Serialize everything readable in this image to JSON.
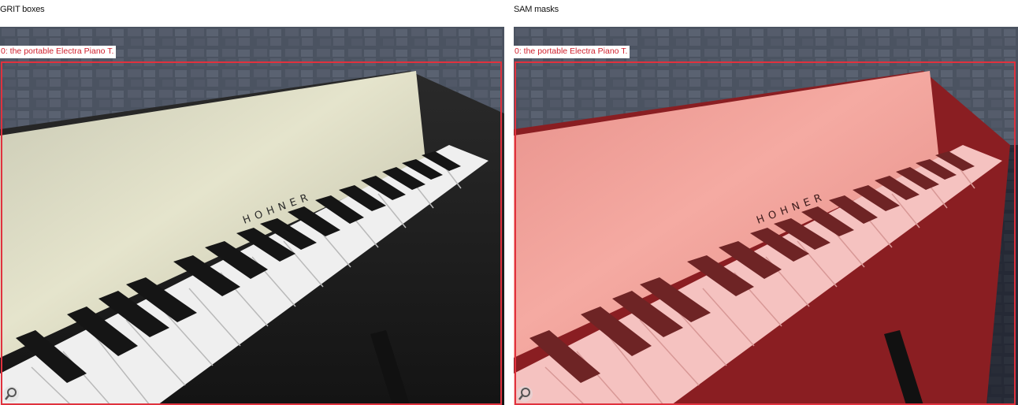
{
  "panels": {
    "left": {
      "title": "GRIT boxes"
    },
    "right": {
      "title": "SAM masks"
    }
  },
  "detection": {
    "label": "0: the portable Electra Piano T."
  },
  "colors": {
    "box": "#e0323e",
    "label_text": "#d0202d",
    "mask": "#ff5a5a"
  },
  "image": {
    "brand_text": "HOHNER"
  },
  "icons": {
    "zoom": "magnifier-icon"
  }
}
